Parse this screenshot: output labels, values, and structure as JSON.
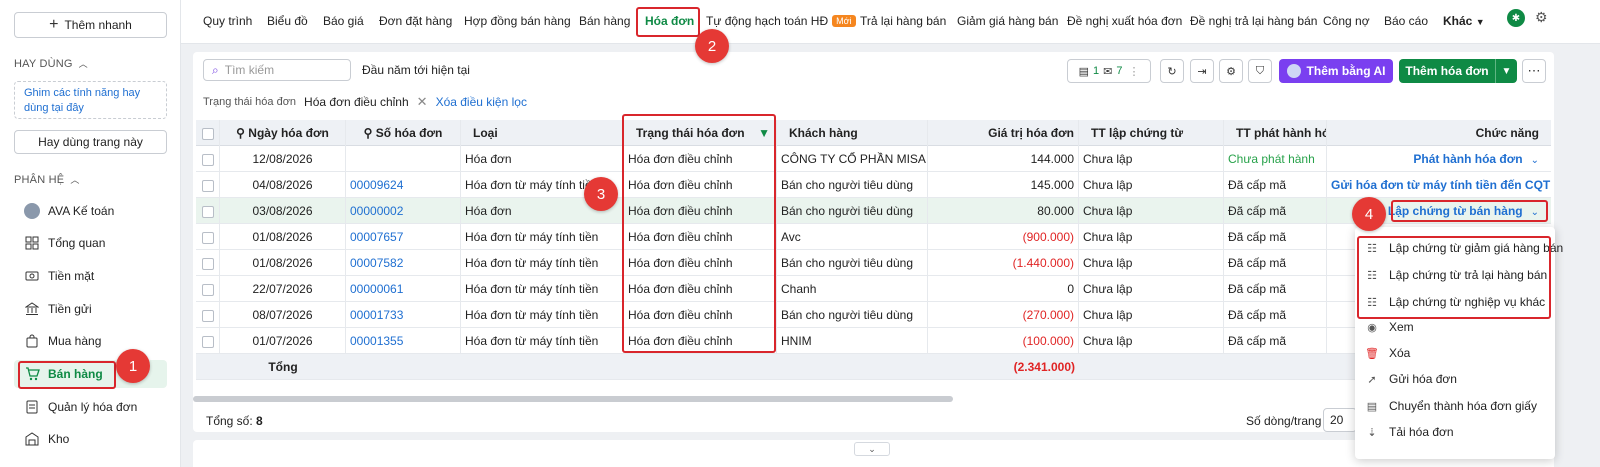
{
  "sidebar": {
    "quick_add": "Thêm nhanh",
    "frequent_title": "HAY DÙNG",
    "pin_hint": "Ghim các tính năng hay dùng tại đây",
    "stay_button": "Hay dùng trang này",
    "modules_title": "PHÂN HỆ",
    "items": [
      {
        "label": "AVA Kế toán",
        "icon": "ava-avatar-icon"
      },
      {
        "label": "Tổng quan",
        "icon": "dashboard-icon"
      },
      {
        "label": "Tiền mặt",
        "icon": "cash-icon"
      },
      {
        "label": "Tiền gửi",
        "icon": "bank-icon"
      },
      {
        "label": "Mua hàng",
        "icon": "shopping-bag-icon"
      },
      {
        "label": "Bán hàng",
        "icon": "cart-icon"
      },
      {
        "label": "Quản lý hóa đơn",
        "icon": "invoice-icon"
      },
      {
        "label": "Kho",
        "icon": "warehouse-icon"
      }
    ]
  },
  "tabs": [
    "Quy trình",
    "Biểu đồ",
    "Báo giá",
    "Đơn đặt hàng",
    "Hợp đồng bán hàng",
    "Bán hàng",
    "Hóa đơn",
    "Tự động hạch toán HĐ",
    "Trả lại hàng bán",
    "Giảm giá hàng bán",
    "Đề nghị xuất hóa đơn",
    "Đề nghị trả lại hàng bán",
    "Công nợ",
    "Báo cáo",
    "Khác"
  ],
  "tab_new_badge": "Mới",
  "toolbar": {
    "search_placeholder": "Tìm kiếm",
    "period": "Đầu năm tới hiện tại",
    "filter_label": "Trạng thái hóa đơn",
    "filter_value": "Hóa đơn điều chỉnh",
    "clear_filter": "Xóa điều kiện lọc",
    "count_1": "1",
    "count_7": "7",
    "ai_button": "Thêm bằng AI",
    "add_button": "Thêm hóa đơn"
  },
  "table": {
    "columns": [
      "Ngày hóa đơn",
      "Số hóa đơn",
      "Loại",
      "Trạng thái hóa đơn",
      "Khách hàng",
      "Giá trị hóa đơn",
      "TT lập chứng từ",
      "TT phát hành hóa",
      "Chức năng"
    ],
    "rows": [
      {
        "date": "12/08/2026",
        "no": "",
        "type": "Hóa đơn",
        "status": "Hóa đơn điều chỉnh",
        "customer": "CÔNG TY CỔ PHẦN MISA",
        "value": "144.000",
        "doc": "Chưa lập",
        "issue": "Chưa phát hành",
        "action": "Phát hành hóa đơn"
      },
      {
        "date": "04/08/2026",
        "no": "00009624",
        "type": "Hóa đơn từ máy tính tiền",
        "status": "Hóa đơn điều chỉnh",
        "customer": "Bán cho người tiêu dùng",
        "value": "145.000",
        "doc": "Chưa lập",
        "issue": "Đã cấp mã",
        "action": "Gửi hóa đơn từ máy tính tiền đến CQT"
      },
      {
        "date": "03/08/2026",
        "no": "00000002",
        "type": "Hóa đơn",
        "status": "Hóa đơn điều chỉnh",
        "customer": "Bán cho người tiêu dùng",
        "value": "80.000",
        "doc": "Chưa lập",
        "issue": "Đã cấp mã",
        "action": "Lập chứng từ bán hàng"
      },
      {
        "date": "01/08/2026",
        "no": "00007657",
        "type": "Hóa đơn từ máy tính tiền",
        "status": "Hóa đơn điều chỉnh",
        "customer": "Avc",
        "value": "(900.000)",
        "doc": "Chưa lập",
        "issue": "Đã cấp mã",
        "action": ""
      },
      {
        "date": "01/08/2026",
        "no": "00007582",
        "type": "Hóa đơn từ máy tính tiền",
        "status": "Hóa đơn điều chỉnh",
        "customer": "Bán cho người tiêu dùng",
        "value": "(1.440.000)",
        "doc": "Chưa lập",
        "issue": "Đã cấp mã",
        "action": ""
      },
      {
        "date": "22/07/2026",
        "no": "00000061",
        "type": "Hóa đơn từ máy tính tiền",
        "status": "Hóa đơn điều chỉnh",
        "customer": "Chanh",
        "value": "0",
        "doc": "Chưa lập",
        "issue": "Đã cấp mã",
        "action": ""
      },
      {
        "date": "08/07/2026",
        "no": "00001733",
        "type": "Hóa đơn từ máy tính tiền",
        "status": "Hóa đơn điều chỉnh",
        "customer": "Bán cho người tiêu dùng",
        "value": "(270.000)",
        "doc": "Chưa lập",
        "issue": "Đã cấp mã",
        "action": ""
      },
      {
        "date": "01/07/2026",
        "no": "00001355",
        "type": "Hóa đơn từ máy tính tiền",
        "status": "Hóa đơn điều chỉnh",
        "customer": "HNIM",
        "value": "(100.000)",
        "doc": "Chưa lập",
        "issue": "Đã cấp mã",
        "action": ""
      }
    ],
    "total_label": "Tổng",
    "total_value": "(2.341.000)"
  },
  "footer": {
    "total_count_label": "Tổng số:",
    "total_count": "8",
    "rows_per_page_label": "Số dòng/trang",
    "rows_per_page": "20"
  },
  "dropdown": [
    {
      "label": "Lập chứng từ giảm giá hàng bán",
      "icon": "document-list-icon"
    },
    {
      "label": "Lập chứng từ trả lại hàng bán",
      "icon": "document-list-icon"
    },
    {
      "label": "Lập chứng từ nghiệp vụ khác",
      "icon": "document-list-icon"
    },
    {
      "label": "Xem",
      "icon": "eye-icon"
    },
    {
      "label": "Xóa",
      "icon": "trash-icon"
    },
    {
      "label": "Gửi hóa đơn",
      "icon": "send-icon"
    },
    {
      "label": "Chuyển thành hóa đơn giấy",
      "icon": "paper-invoice-icon"
    },
    {
      "label": "Tải hóa đơn",
      "icon": "download-icon"
    }
  ],
  "callouts": [
    "1",
    "2",
    "3",
    "4"
  ],
  "colors": {
    "brand_green": "#0f8a45",
    "ai_purple": "#7a3ff0",
    "callout_red": "#e53935",
    "link_blue": "#1f6fd1",
    "negative_red": "#e02424"
  }
}
